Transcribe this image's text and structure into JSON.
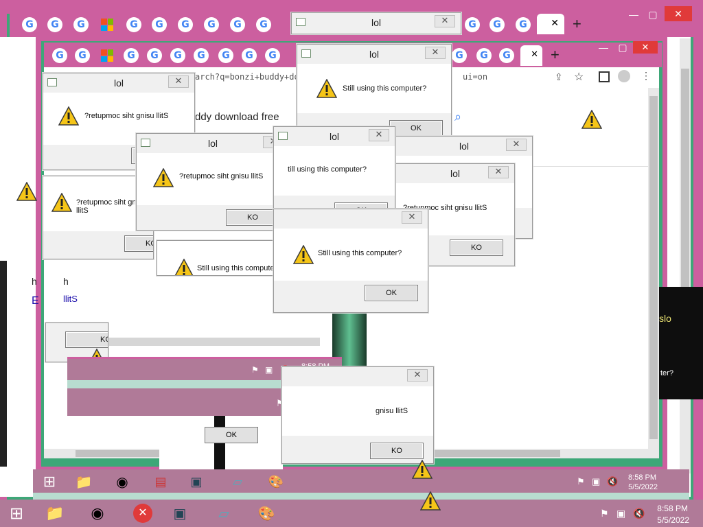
{
  "dialog": {
    "title": "lol",
    "message": "Still using this computer?",
    "message_reversed": "?retupmoc siht gnisu llitS",
    "ok": "OK",
    "ok_reversed": "KO",
    "message_cut_a": "Still using this compute",
    "message_cut_b": "till using this computer?",
    "message_cut_c": "gnisu llitS"
  },
  "browser": {
    "address_fragment": "arch?q=bonzi+buddy+dow",
    "address_tail": "ui=on",
    "search_fragment": "ddy download free",
    "side_text_1": "h",
    "side_text_2": "llitS",
    "side_text_3": "E",
    "side_text_4": "slo",
    "side_text_5": "ter?"
  },
  "clock": {
    "time": "8:58 PM",
    "date": "5/5/2022"
  },
  "colors": {
    "chrome_pink": "#cc5f9f",
    "taskbar_mauve": "#b07a98",
    "accent_green": "#2e8b57"
  },
  "icons": [
    "google-icon",
    "microsoft-icon",
    "warning-icon",
    "close-icon",
    "file-explorer-icon",
    "chrome-icon",
    "start-icon",
    "error-icon",
    "paint-icon",
    "network-icon",
    "volume-mute-icon",
    "flag-icon"
  ]
}
